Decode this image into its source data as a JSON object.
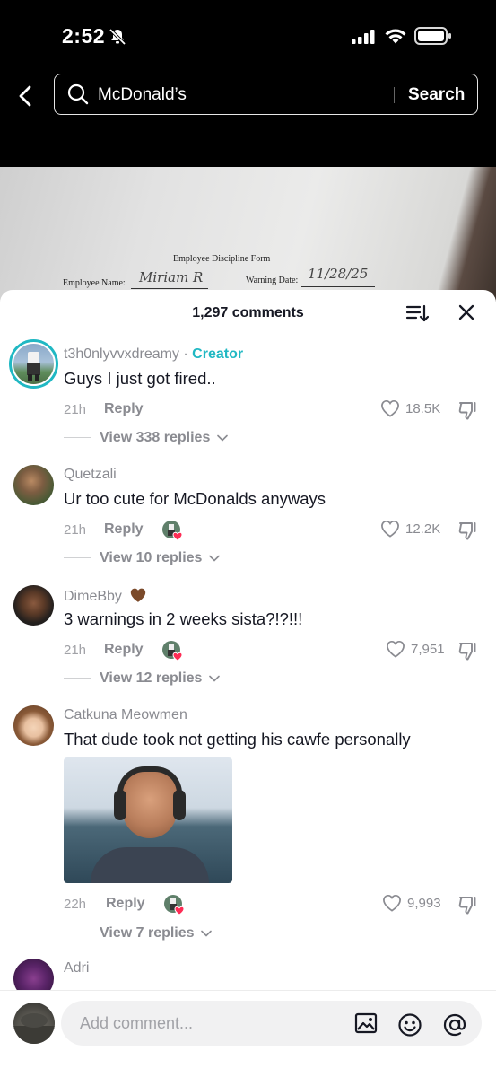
{
  "status_bar": {
    "time": "2:52"
  },
  "search": {
    "query": "McDonald’s",
    "button_label": "Search"
  },
  "video": {
    "form_title": "Employee Discipline Form",
    "employee_name_label": "Employee Name:",
    "employee_name_value": "Miriam R",
    "warning_date_label": "Warning Date:",
    "warning_date_value": "11/28/25"
  },
  "panel": {
    "title": "1,297 comments"
  },
  "comments": [
    {
      "username": "t3h0nlyvvxdreamy",
      "badge_sep": " · ",
      "badge": "Creator",
      "text": "Guys I just got fired..",
      "time": "21h",
      "reply": "Reply",
      "likes": "18.5K",
      "view_replies": "View 338 replies"
    },
    {
      "username": "Quetzali",
      "text": "Ur too cute for McDonalds anyways",
      "time": "21h",
      "reply": "Reply",
      "likes": "12.2K",
      "view_replies": "View 10 replies"
    },
    {
      "username": "DimeBby",
      "text": "3 warnings in 2 weeks sista?!?!!!",
      "time": "21h",
      "reply": "Reply",
      "likes": "7,951",
      "view_replies": "View 12 replies"
    },
    {
      "username": "Catkuna Meowmen",
      "text": "That dude took not getting his cawfe personally",
      "time": "22h",
      "reply": "Reply",
      "likes": "9,993",
      "view_replies": "View 7 replies"
    },
    {
      "username": "Adri"
    }
  ],
  "composer": {
    "placeholder": "Add comment..."
  },
  "colors": {
    "creator_accent": "#20b8c3",
    "heart_red": "#fe2c55",
    "muted": "#8a8b91"
  }
}
